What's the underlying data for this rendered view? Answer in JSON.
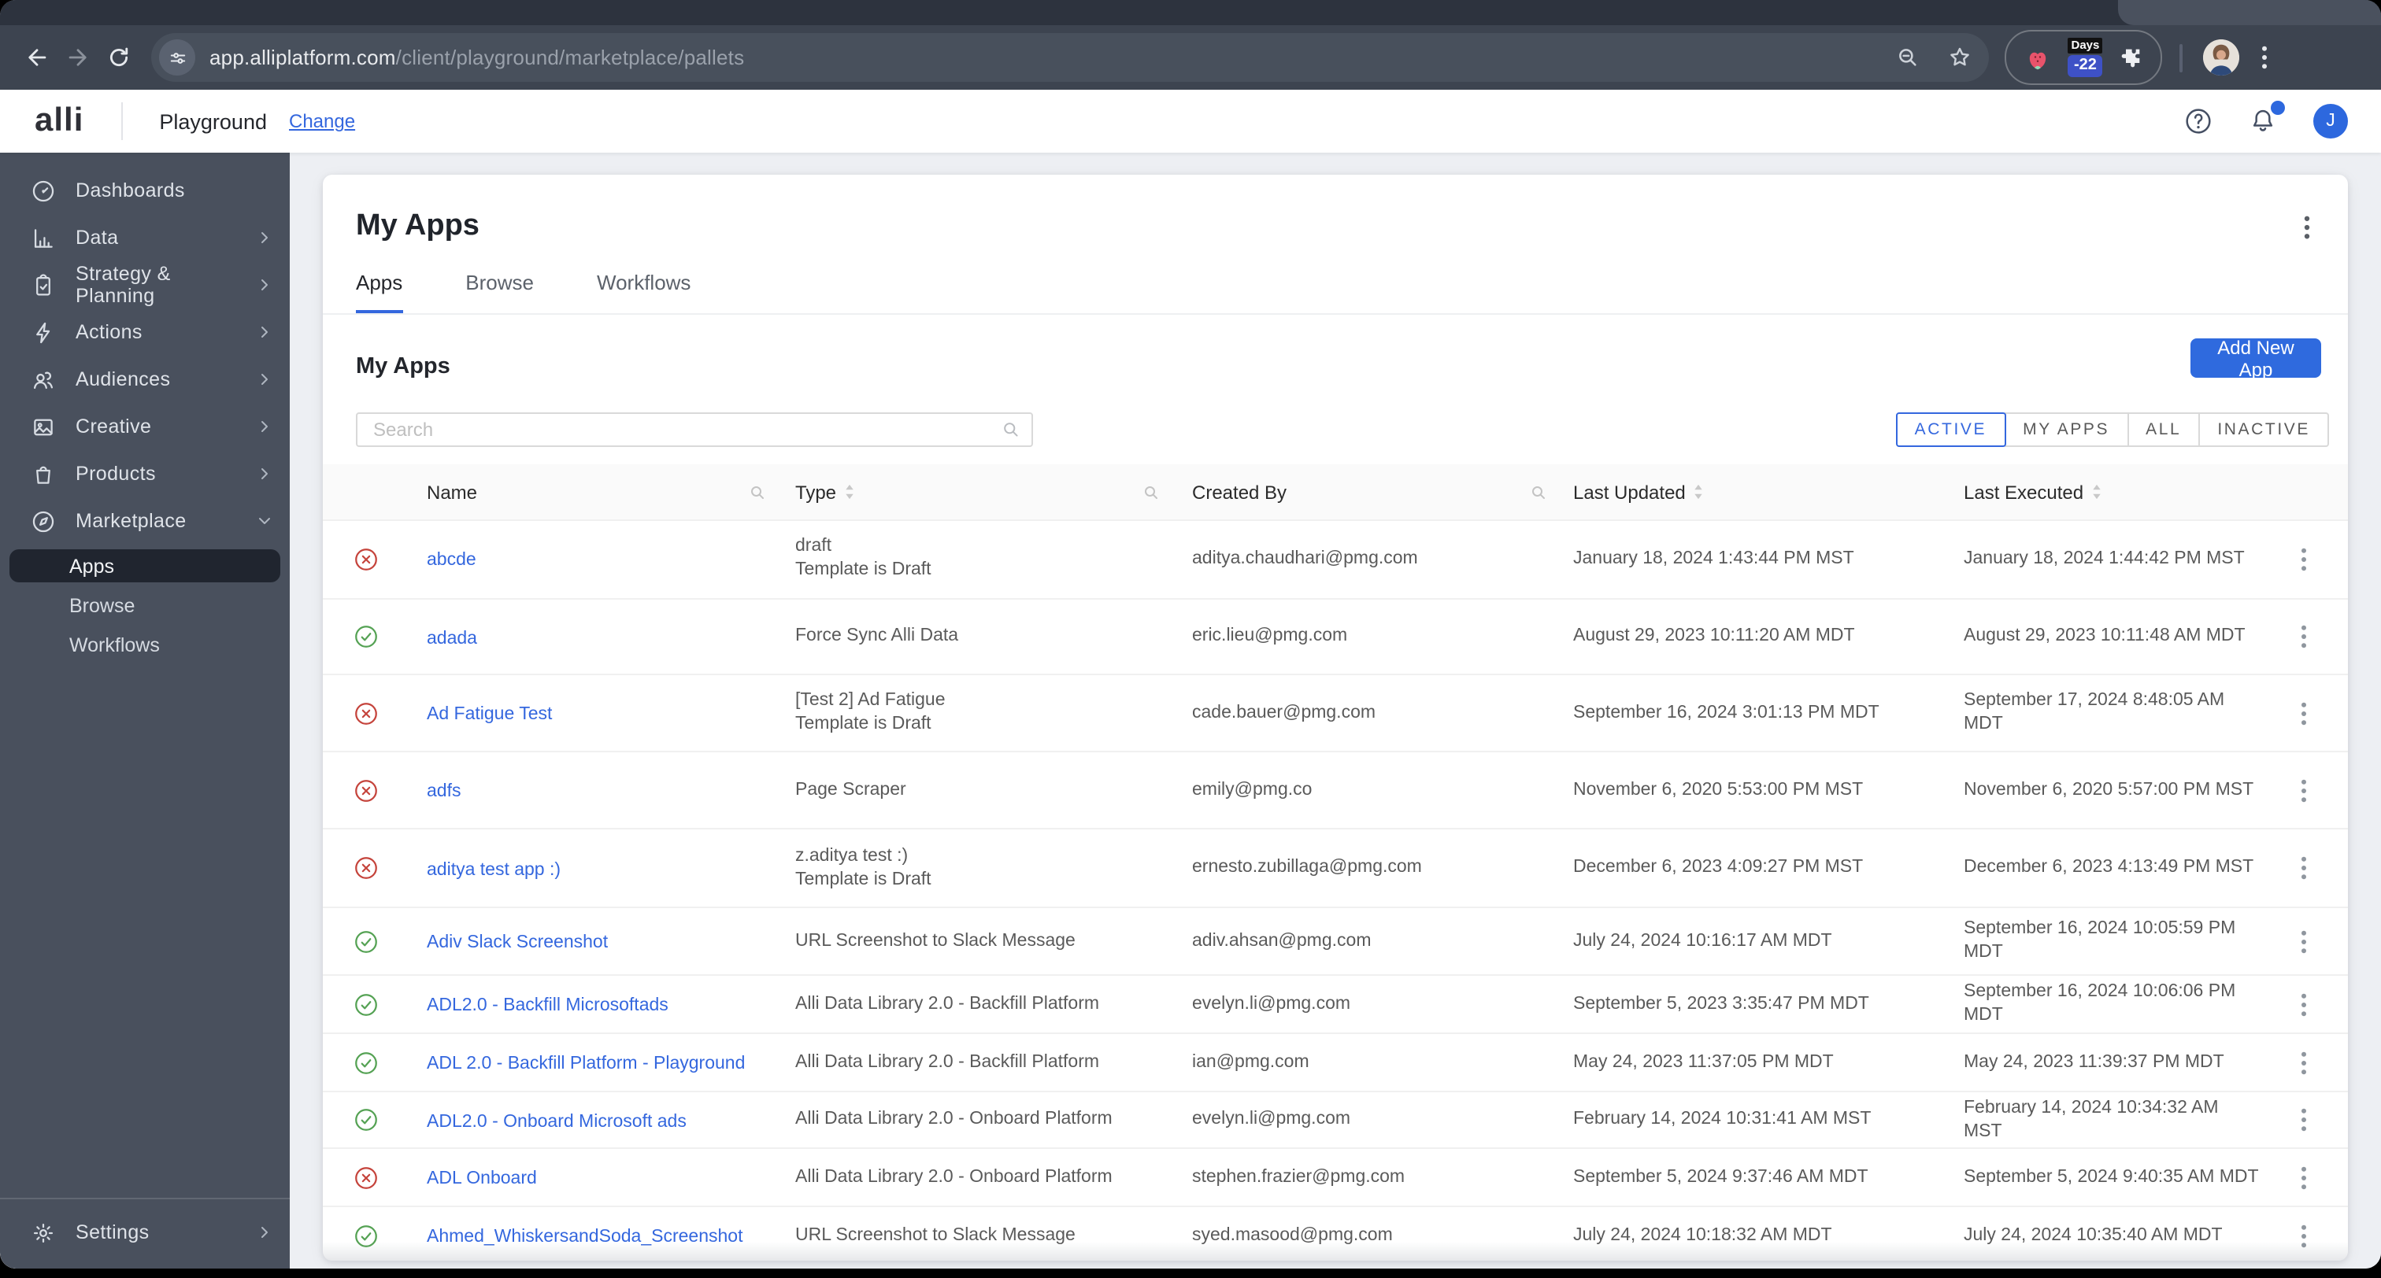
{
  "browser": {
    "url": {
      "domain": "app.alliplatform.com",
      "path": "/client/playground/marketplace/pallets"
    },
    "extension_badge": {
      "top": "Days",
      "bottom": "-22"
    }
  },
  "header": {
    "brand": "alli",
    "workspace": "Playground",
    "change_link": "Change",
    "user_initial": "J"
  },
  "sidebar": {
    "items": [
      {
        "label": "Dashboards",
        "icon": "gauge",
        "chevron": ""
      },
      {
        "label": "Data",
        "icon": "bar-chart",
        "chevron": "right"
      },
      {
        "label": "Strategy & Planning",
        "icon": "clipboard",
        "chevron": "right"
      },
      {
        "label": "Actions",
        "icon": "bolt",
        "chevron": "right"
      },
      {
        "label": "Audiences",
        "icon": "users",
        "chevron": "right"
      },
      {
        "label": "Creative",
        "icon": "image",
        "chevron": "right"
      },
      {
        "label": "Products",
        "icon": "bag",
        "chevron": "right"
      },
      {
        "label": "Marketplace",
        "icon": "compass",
        "chevron": "down",
        "children": [
          {
            "label": "Apps",
            "active": true
          },
          {
            "label": "Browse",
            "active": false
          },
          {
            "label": "Workflows",
            "active": false
          }
        ]
      }
    ],
    "settings": {
      "label": "Settings",
      "icon": "gear",
      "chevron": "right"
    }
  },
  "main": {
    "page_title": "My Apps",
    "tabs": [
      {
        "label": "Apps",
        "active": true
      },
      {
        "label": "Browse",
        "active": false
      },
      {
        "label": "Workflows",
        "active": false
      }
    ],
    "section_title": "My Apps",
    "add_button": "Add New App",
    "search_placeholder": "Search",
    "filters": [
      {
        "label": "ACTIVE",
        "active": true
      },
      {
        "label": "MY APPS",
        "active": false
      },
      {
        "label": "ALL",
        "active": false
      },
      {
        "label": "INACTIVE",
        "active": false
      }
    ]
  },
  "table": {
    "columns": [
      "Name",
      "Type",
      "Created By",
      "Last Updated",
      "Last Executed"
    ],
    "rows": [
      {
        "status": "error",
        "name": "abcde",
        "type": [
          "draft",
          "Template is Draft"
        ],
        "created_by": "aditya.chaudhari@pmg.com",
        "last_updated": "January 18, 2024 1:43:44 PM MST",
        "last_executed": "January 18, 2024 1:44:42 PM MST"
      },
      {
        "status": "ok",
        "name": "adada",
        "type": [
          "Force Sync Alli Data"
        ],
        "created_by": "eric.lieu@pmg.com",
        "last_updated": "August 29, 2023 10:11:20 AM MDT",
        "last_executed": "August 29, 2023 10:11:48 AM MDT"
      },
      {
        "status": "error",
        "name": "Ad Fatigue Test",
        "type": [
          "[Test 2] Ad Fatigue",
          "Template is Draft"
        ],
        "created_by": "cade.bauer@pmg.com",
        "last_updated": "September 16, 2024 3:01:13 PM MDT",
        "last_executed": "September 17, 2024 8:48:05 AM MDT"
      },
      {
        "status": "error",
        "name": "adfs",
        "type": [
          "Page Scraper"
        ],
        "created_by": "emily@pmg.co",
        "last_updated": "November 6, 2020 5:53:00 PM MST",
        "last_executed": "November 6, 2020 5:57:00 PM MST"
      },
      {
        "status": "error",
        "name": "aditya test app :)",
        "type": [
          "z.aditya test :)",
          "Template is Draft"
        ],
        "created_by": "ernesto.zubillaga@pmg.com",
        "last_updated": "December 6, 2023 4:09:27 PM MST",
        "last_executed": "December 6, 2023 4:13:49 PM MST"
      },
      {
        "status": "ok",
        "name": "Adiv Slack Screenshot",
        "type": [
          "URL Screenshot to Slack Message"
        ],
        "created_by": "adiv.ahsan@pmg.com",
        "last_updated": "July 24, 2024 10:16:17 AM MDT",
        "last_executed": "September 16, 2024 10:05:59 PM MDT"
      },
      {
        "status": "ok",
        "name": "ADL2.0 - Backfill Microsoftads",
        "type": [
          "Alli Data Library 2.0 - Backfill Platform"
        ],
        "created_by": "evelyn.li@pmg.com",
        "last_updated": "September 5, 2023 3:35:47 PM MDT",
        "last_executed": "September 16, 2024 10:06:06 PM MDT"
      },
      {
        "status": "ok",
        "name": "ADL 2.0 - Backfill Platform - Playground",
        "type": [
          "Alli Data Library 2.0 - Backfill Platform"
        ],
        "created_by": "ian@pmg.com",
        "last_updated": "May 24, 2023 11:37:05 PM MDT",
        "last_executed": "May 24, 2023 11:39:37 PM MDT"
      },
      {
        "status": "ok",
        "name": "ADL2.0 - Onboard Microsoft ads",
        "type": [
          "Alli Data Library 2.0 - Onboard Platform"
        ],
        "created_by": "evelyn.li@pmg.com",
        "last_updated": "February 14, 2024 10:31:41 AM MST",
        "last_executed": "February 14, 2024 10:34:32 AM MST"
      },
      {
        "status": "error",
        "name": "ADL Onboard",
        "type": [
          "Alli Data Library 2.0 - Onboard Platform"
        ],
        "created_by": "stephen.frazier@pmg.com",
        "last_updated": "September 5, 2024 9:37:46 AM MDT",
        "last_executed": "September 5, 2024 9:40:35 AM MDT"
      },
      {
        "status": "ok",
        "name": "Ahmed_WhiskersandSoda_Screenshot",
        "type": [
          "URL Screenshot to Slack Message"
        ],
        "created_by": "syed.masood@pmg.com",
        "last_updated": "July 24, 2024 10:18:32 AM MDT",
        "last_executed": "July 24, 2024 10:35:40 AM MDT"
      }
    ]
  },
  "colors": {
    "accent_blue": "#2f6ade",
    "link_blue": "#3467de",
    "status_ok": "#55a254",
    "status_error": "#c5443c",
    "sidebar_bg": "#49505d"
  }
}
